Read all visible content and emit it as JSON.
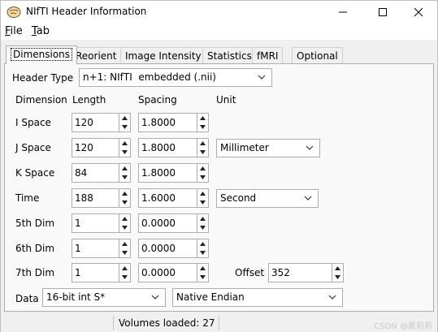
{
  "window": {
    "title": "NIfTI Header Information"
  },
  "menu": {
    "file": {
      "accel": "F",
      "rest": "ile"
    },
    "tab": {
      "accel": "T",
      "rest": "ab"
    }
  },
  "tabs": [
    "Dimensions",
    "Reorient",
    "Image Intensity",
    "Statistics",
    "fMRI",
    "Optional"
  ],
  "header_type": {
    "label": "Header Type",
    "value": "n+1: NIfTI  embedded (.nii)"
  },
  "columns": {
    "dimension": "Dimension",
    "length": "Length",
    "spacing": "Spacing",
    "unit": "Unit"
  },
  "rows": [
    {
      "name": "I Space",
      "length": "120",
      "spacing": "1.8000"
    },
    {
      "name": "J Space",
      "length": "120",
      "spacing": "1.8000",
      "unit": "Millimeter"
    },
    {
      "name": "K Space",
      "length": "84",
      "spacing": "1.8000"
    },
    {
      "name": "Time",
      "length": "188",
      "spacing": "1.6000",
      "unit": "Second"
    },
    {
      "name": "5th Dim",
      "length": "1",
      "spacing": "0.0000"
    },
    {
      "name": "6th Dim",
      "length": "1",
      "spacing": "0.0000"
    },
    {
      "name": "7th Dim",
      "length": "1",
      "spacing": "0.0000"
    }
  ],
  "offset": {
    "label": "Offset",
    "value": "352"
  },
  "data": {
    "label": "Data",
    "type": "16-bit int S*",
    "endian": "Native Endian"
  },
  "status": {
    "text": "Volumes loaded: 27",
    "watermark": "CSDN @夏莉莉"
  }
}
